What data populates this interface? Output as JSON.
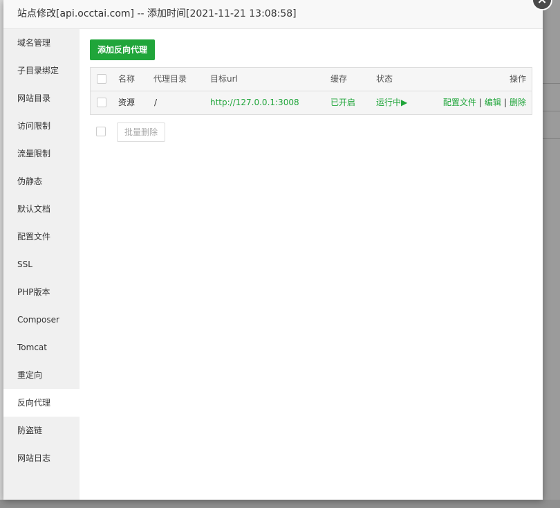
{
  "dialog": {
    "title": "站点修改[api.occtai.com] -- 添加时间[2021-11-21 13:08:58]",
    "close_icon": "×"
  },
  "sidebar": {
    "items": [
      {
        "label": "域名管理"
      },
      {
        "label": "子目录绑定"
      },
      {
        "label": "网站目录"
      },
      {
        "label": "访问限制"
      },
      {
        "label": "流量限制"
      },
      {
        "label": "伪静态"
      },
      {
        "label": "默认文档"
      },
      {
        "label": "配置文件"
      },
      {
        "label": "SSL"
      },
      {
        "label": "PHP版本"
      },
      {
        "label": "Composer"
      },
      {
        "label": "Tomcat"
      },
      {
        "label": "重定向"
      },
      {
        "label": "反向代理"
      },
      {
        "label": "防盗链"
      },
      {
        "label": "网站日志"
      }
    ],
    "active": "反向代理"
  },
  "main": {
    "add_button": "添加反向代理",
    "table": {
      "headers": {
        "name": "名称",
        "dir": "代理目录",
        "url": "目标url",
        "cache": "缓存",
        "status": "状态",
        "ops": "操作"
      },
      "rows": [
        {
          "name": "资源",
          "dir": "/",
          "url": "http://127.0.0.1:3008",
          "cache": "已开启",
          "status": "运行中▶",
          "op_config": "配置文件",
          "op_edit": "编辑",
          "op_delete": "删除",
          "separator": "|"
        }
      ]
    },
    "batch_delete": "批量删除"
  },
  "colors": {
    "accent": "#20a53a",
    "sidebar_bg": "#f0f0f0",
    "title_bg": "#f8f8f8"
  }
}
